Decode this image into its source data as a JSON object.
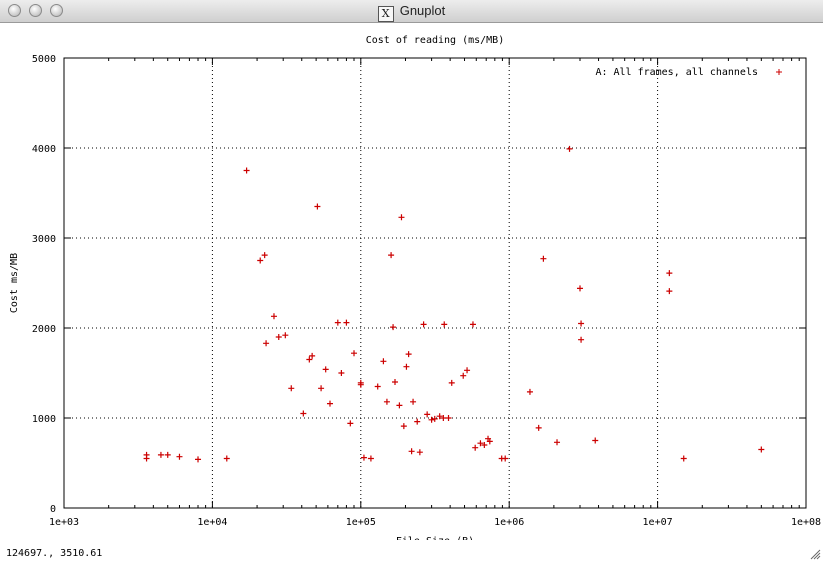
{
  "window": {
    "title": "Gnuplot",
    "app_icon": "X",
    "icon_name": "x11-icon"
  },
  "status_bar": {
    "coordinates": "124697.,  3510.61"
  },
  "chart_data": {
    "type": "scatter",
    "title": "Cost of reading (ms/MB)",
    "xlabel": "File Size (B)",
    "ylabel": "Cost ms/MB",
    "x_scale": "log",
    "xlim": [
      1000,
      100000000
    ],
    "ylim": [
      0,
      5000
    ],
    "x_ticks": [
      {
        "value": 1000,
        "label": "1e+03"
      },
      {
        "value": 10000,
        "label": "1e+04"
      },
      {
        "value": 100000,
        "label": "1e+05"
      },
      {
        "value": 1000000,
        "label": "1e+06"
      },
      {
        "value": 10000000,
        "label": "1e+07"
      },
      {
        "value": 100000000,
        "label": "1e+08"
      }
    ],
    "y_ticks": [
      {
        "value": 0,
        "label": "0"
      },
      {
        "value": 1000,
        "label": "1000"
      },
      {
        "value": 2000,
        "label": "2000"
      },
      {
        "value": 3000,
        "label": "3000"
      },
      {
        "value": 4000,
        "label": "4000"
      },
      {
        "value": 5000,
        "label": "5000"
      }
    ],
    "grid": true,
    "legend_position": "top-right",
    "marker": "+",
    "series": [
      {
        "name": "A: All frames, all channels",
        "color": "#cc0000",
        "points": [
          [
            3600,
            590
          ],
          [
            3600,
            550
          ],
          [
            4500,
            590
          ],
          [
            5000,
            590
          ],
          [
            6000,
            570
          ],
          [
            8000,
            540
          ],
          [
            12500,
            550
          ],
          [
            17000,
            3750
          ],
          [
            21000,
            2750
          ],
          [
            22500,
            2810
          ],
          [
            23000,
            1830
          ],
          [
            26000,
            2130
          ],
          [
            28000,
            1900
          ],
          [
            31000,
            1920
          ],
          [
            34000,
            1330
          ],
          [
            41000,
            1050
          ],
          [
            45000,
            1650
          ],
          [
            47000,
            1690
          ],
          [
            51000,
            3350
          ],
          [
            54000,
            1330
          ],
          [
            58000,
            1540
          ],
          [
            62000,
            1160
          ],
          [
            70000,
            2060
          ],
          [
            74000,
            1500
          ],
          [
            80000,
            2060
          ],
          [
            85000,
            940
          ],
          [
            90000,
            1720
          ],
          [
            100000,
            1390
          ],
          [
            100000,
            1370
          ],
          [
            105000,
            560
          ],
          [
            117000,
            550
          ],
          [
            130000,
            1350
          ],
          [
            142000,
            1630
          ],
          [
            150000,
            1180
          ],
          [
            160000,
            2810
          ],
          [
            165000,
            2010
          ],
          [
            170000,
            1400
          ],
          [
            182000,
            1140
          ],
          [
            188000,
            3230
          ],
          [
            195000,
            910
          ],
          [
            203000,
            1570
          ],
          [
            210000,
            1710
          ],
          [
            220000,
            630
          ],
          [
            225000,
            1180
          ],
          [
            240000,
            960
          ],
          [
            250000,
            620
          ],
          [
            265000,
            2040
          ],
          [
            280000,
            1040
          ],
          [
            300000,
            980
          ],
          [
            315000,
            990
          ],
          [
            340000,
            1020
          ],
          [
            365000,
            2040
          ],
          [
            360000,
            1000
          ],
          [
            390000,
            1000
          ],
          [
            410000,
            1390
          ],
          [
            490000,
            1470
          ],
          [
            520000,
            1530
          ],
          [
            570000,
            2040
          ],
          [
            590000,
            670
          ],
          [
            640000,
            720
          ],
          [
            680000,
            700
          ],
          [
            720000,
            770
          ],
          [
            740000,
            740
          ],
          [
            890000,
            550
          ],
          [
            940000,
            550
          ],
          [
            1380000,
            1290
          ],
          [
            1580000,
            890
          ],
          [
            1700000,
            2770
          ],
          [
            2100000,
            730
          ],
          [
            2550000,
            3990
          ],
          [
            3000000,
            2440
          ],
          [
            3050000,
            2050
          ],
          [
            3050000,
            1870
          ],
          [
            3800000,
            750
          ],
          [
            12000000,
            2610
          ],
          [
            12000000,
            2410
          ],
          [
            15000000,
            550
          ],
          [
            50000000,
            650
          ]
        ]
      }
    ]
  }
}
